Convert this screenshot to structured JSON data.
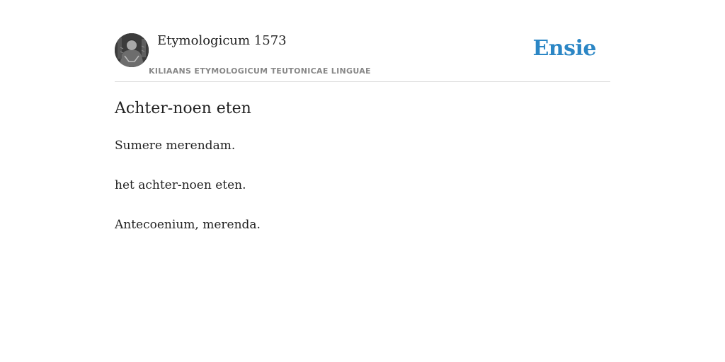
{
  "header": {
    "source_title": "Etymologicum 1573",
    "source_subtitle": "KILIAANS ETYMOLOGICUM TEUTONICAE LINGUAE",
    "brand": "Ensie",
    "avatar_icon": "portrait-engraving-icon"
  },
  "entry": {
    "title": "Achter-noen eten",
    "lines": [
      "Sumere merendam.",
      "het achter-noen eten.",
      "Antecoenium, merenda."
    ]
  },
  "colors": {
    "brand": "#2b86c5",
    "text": "#222222",
    "subtitle": "#888888",
    "divider": "#dddddd"
  }
}
